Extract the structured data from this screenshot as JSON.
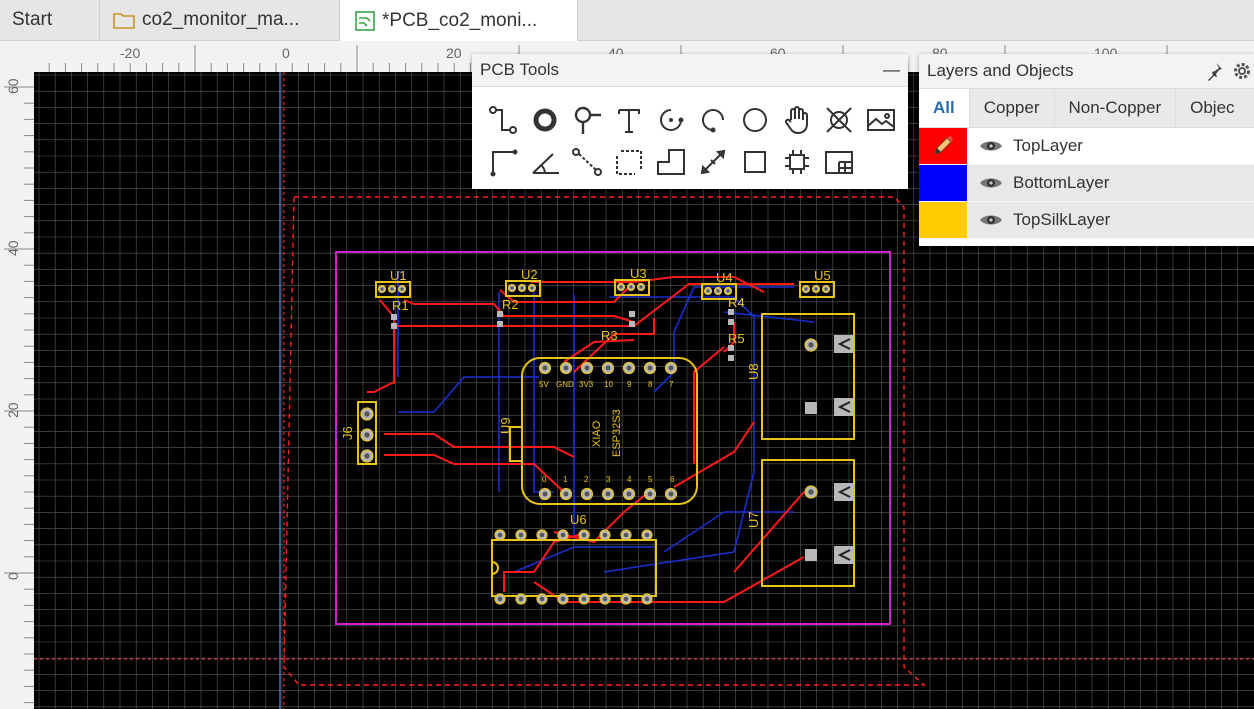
{
  "tabs": [
    {
      "label": "Start"
    },
    {
      "label": "co2_monitor_ma..."
    },
    {
      "label": "*PCB_co2_moni..."
    }
  ],
  "ruler": {
    "top_ticks": [
      "-20",
      "0",
      "20",
      "40",
      "60",
      "80",
      "100"
    ],
    "left_ticks": [
      "60",
      "40",
      "20",
      "0"
    ]
  },
  "pcb_tools": {
    "title": "PCB Tools",
    "minimize": "—",
    "tools": [
      "track-icon",
      "pad-icon",
      "via-icon",
      "text-icon",
      "arc-icon",
      "arc-ccw-icon",
      "circle-icon",
      "pan-icon",
      "no-connect-icon",
      "image-icon",
      "line-icon",
      "angle-icon",
      "connect-icon",
      "dashed-rect-icon",
      "polyline-icon",
      "dimension-icon",
      "rect-icon",
      "component-icon",
      "copper-area-icon"
    ]
  },
  "layers_panel": {
    "title": "Layers and Objects",
    "tabs": [
      "All",
      "Copper",
      "Non-Copper",
      "Objec"
    ],
    "layers": [
      {
        "name": "TopLayer",
        "color": "#ff0000"
      },
      {
        "name": "BottomLayer",
        "color": "#0000ff"
      },
      {
        "name": "TopSilkLayer",
        "color": "#ffcc00"
      }
    ]
  },
  "board": {
    "designators": [
      "U1",
      "U2",
      "U3",
      "U4",
      "U5",
      "R1",
      "R2",
      "R3",
      "R4",
      "R5",
      "U6",
      "U7",
      "U8",
      "U9",
      "J6"
    ],
    "xiao": {
      "label1": "XIAO",
      "label2": "ESP32S3",
      "top_pins": [
        "5V",
        "GND",
        "3V3",
        "10",
        "9",
        "8",
        "7"
      ],
      "bottom_pins": [
        "0",
        "1",
        "2",
        "3",
        "4",
        "5",
        "6"
      ]
    }
  }
}
